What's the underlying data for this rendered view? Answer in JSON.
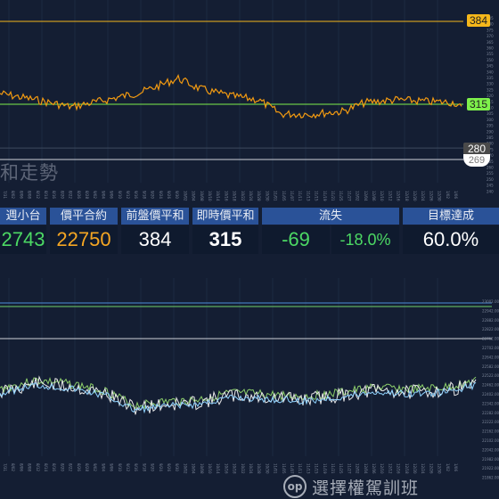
{
  "top_chart": {
    "price_high": "384",
    "price_now": "315",
    "price_low": "280",
    "price_low2": "269",
    "watermark": "和走勢",
    "colors": {
      "line": "#f29a11",
      "high_line": "#f5b71b",
      "now_line": "#7ef04b",
      "low_line": "#cfd3da"
    },
    "y_ticks": [
      "385",
      "380",
      "375",
      "370",
      "365",
      "360",
      "355",
      "350",
      "345",
      "340",
      "335",
      "330",
      "325",
      "320",
      "315",
      "310",
      "305",
      "300",
      "295",
      "290",
      "285",
      "280",
      "275",
      "270",
      "265",
      "260",
      "255",
      "250",
      "245",
      "240"
    ],
    "x_ticks": [
      "7/31",
      "8/02",
      "8/06",
      "8/08",
      "8/12",
      "8/14",
      "8/16",
      "8/20",
      "8/22",
      "8/26",
      "8/28",
      "9/02",
      "9/04",
      "9/06",
      "9/10",
      "9/12",
      "9/16",
      "9/18",
      "9/20",
      "9/24",
      "9/26",
      "9/30",
      "10/02",
      "10/04",
      "10/08",
      "10/10",
      "10/14",
      "10/16",
      "10/18",
      "10/22",
      "10/24",
      "10/28",
      "10/30",
      "11/01",
      "11/05",
      "11/07",
      "11/11",
      "11/13",
      "11/15",
      "11/19",
      "11/21",
      "11/25",
      "11/27",
      "12/02",
      "12/04",
      "12/06",
      "12/10",
      "12/12",
      "12/16",
      "12/18",
      "12/20",
      "12/24",
      "12/26",
      "12/30",
      "1/02",
      "1/06"
    ]
  },
  "panel": {
    "headers": [
      "週小台",
      "價平合約",
      "前盤價平和",
      "即時價平和",
      "流失",
      "目標達成"
    ],
    "values": {
      "contract_week": "2743",
      "atm_contract": "22750",
      "prev_sum": "384",
      "live_sum": "315",
      "loss_points": "-69",
      "loss_pct": "-18.0%",
      "target": "60.0%"
    },
    "colors": {
      "green": "#4cd964",
      "orange": "#f5a623",
      "white": "#ffffff",
      "header": "#2a5298"
    }
  },
  "bottom_chart": {
    "colors": {
      "series_a": "#8fd3ff",
      "series_b": "#e8e8e8",
      "series_c": "#8ccf6a",
      "hline": "#cfd3da"
    },
    "y_ticks": [
      "23002.00",
      "22942.00",
      "22882.00",
      "22822.00",
      "22762.00",
      "22702.00",
      "22642.00",
      "22582.00",
      "22522.00",
      "22462.00",
      "22402.00",
      "22342.00",
      "22282.00",
      "22222.00",
      "22162.00",
      "22102.00",
      "22042.00",
      "21982.00",
      "21922.00",
      "21862.00"
    ]
  },
  "brand": {
    "logo": "op",
    "text": "選擇權駕訓班"
  }
}
